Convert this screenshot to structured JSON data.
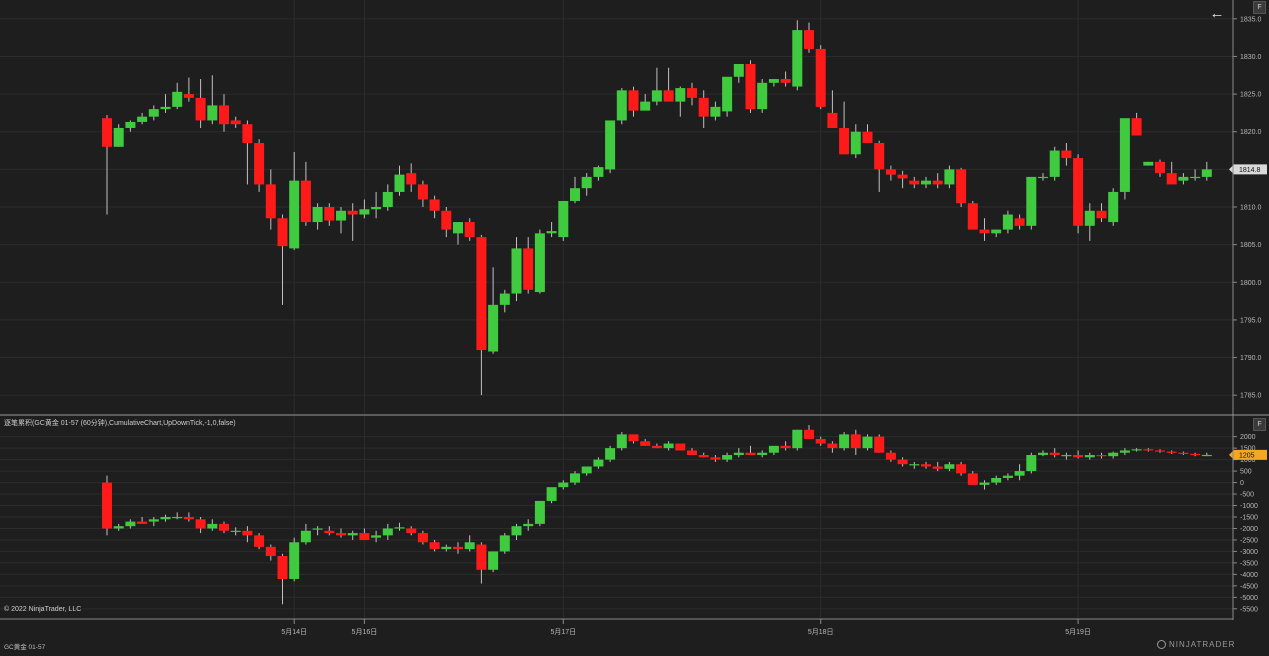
{
  "indicator_label": "逐笔累积(GC黄金 01-57 (60分钟),CumulativeChart,UpDownTick,-1,0,false)",
  "copyright": "© 2022 NinjaTrader, LLC",
  "instrument": "GC黄金 01-57",
  "brand": "NINJATRADER",
  "panel_button": "F",
  "back_icon": "arrow-left-icon",
  "colors": {
    "background": "#1e1e1e",
    "up": "#3fca3f",
    "down": "#ff1a1a",
    "grid": "#2c2c2c",
    "price_marker": "#d9d9d9",
    "indicator_marker": "#f5a623"
  },
  "chart_data": [
    {
      "type": "candlestick",
      "name": "price",
      "ylim": [
        1782.5,
        1837.5
      ],
      "yticks": [
        1785.0,
        1790.0,
        1795.0,
        1800.0,
        1805.0,
        1810.0,
        1815.0,
        1820.0,
        1825.0,
        1830.0,
        1835.0
      ],
      "last_value_label": "1814.8",
      "candles": [
        [
          1821.8,
          1822.2,
          1809.0,
          1818.0
        ],
        [
          1818.0,
          1821.0,
          1818.0,
          1820.5
        ],
        [
          1820.5,
          1821.5,
          1820.0,
          1821.3
        ],
        [
          1821.3,
          1822.5,
          1821.0,
          1822.0
        ],
        [
          1822.0,
          1823.5,
          1821.5,
          1823.0
        ],
        [
          1823.0,
          1825.0,
          1822.5,
          1823.3
        ],
        [
          1823.3,
          1826.5,
          1823.0,
          1825.3
        ],
        [
          1825.0,
          1827.2,
          1824.0,
          1824.5
        ],
        [
          1824.5,
          1827.0,
          1820.5,
          1821.5
        ],
        [
          1821.5,
          1827.5,
          1821.0,
          1823.5
        ],
        [
          1823.5,
          1825.0,
          1820.0,
          1821.0
        ],
        [
          1821.5,
          1822.0,
          1820.5,
          1821.0
        ],
        [
          1821.0,
          1821.5,
          1813.0,
          1818.5
        ],
        [
          1818.5,
          1819.0,
          1812.0,
          1813.0
        ],
        [
          1813.0,
          1815.0,
          1807.0,
          1808.5
        ],
        [
          1808.5,
          1809.0,
          1797.0,
          1804.8
        ],
        [
          1804.5,
          1817.3,
          1804.3,
          1813.5
        ],
        [
          1813.5,
          1816.0,
          1807.5,
          1808.0
        ],
        [
          1808.0,
          1810.5,
          1807.0,
          1810.0
        ],
        [
          1810.0,
          1810.5,
          1807.5,
          1808.2
        ],
        [
          1808.2,
          1810.0,
          1806.5,
          1809.5
        ],
        [
          1809.5,
          1810.5,
          1805.5,
          1809.0
        ],
        [
          1809.0,
          1811.0,
          1808.5,
          1809.7
        ],
        [
          1809.7,
          1812.0,
          1808.5,
          1810.0
        ],
        [
          1810.0,
          1813.0,
          1809.5,
          1812.0
        ],
        [
          1812.0,
          1815.5,
          1811.5,
          1814.3
        ],
        [
          1814.5,
          1815.8,
          1812.0,
          1813.0
        ],
        [
          1813.0,
          1813.5,
          1810.0,
          1811.0
        ],
        [
          1811.0,
          1811.5,
          1808.5,
          1809.5
        ],
        [
          1809.5,
          1810.0,
          1806.0,
          1807.0
        ],
        [
          1806.5,
          1808.0,
          1805.0,
          1808.0
        ],
        [
          1808.0,
          1808.5,
          1805.5,
          1806.0
        ],
        [
          1806.0,
          1806.3,
          1785.0,
          1791.0
        ],
        [
          1790.8,
          1802.0,
          1790.5,
          1797.0
        ],
        [
          1797.0,
          1799.0,
          1796.0,
          1798.5
        ],
        [
          1798.5,
          1806.0,
          1797.5,
          1804.5
        ],
        [
          1804.5,
          1806.0,
          1798.5,
          1799.0
        ],
        [
          1798.7,
          1807.0,
          1798.5,
          1806.5
        ],
        [
          1806.5,
          1808.0,
          1806.0,
          1806.8
        ],
        [
          1806.0,
          1810.5,
          1805.5,
          1810.8
        ],
        [
          1810.8,
          1814.0,
          1810.5,
          1812.5
        ],
        [
          1812.5,
          1814.5,
          1811.5,
          1814.0
        ],
        [
          1814.0,
          1815.5,
          1813.5,
          1815.3
        ],
        [
          1815.0,
          1817.0,
          1814.5,
          1821.5
        ],
        [
          1821.5,
          1825.8,
          1821.0,
          1825.5
        ],
        [
          1825.5,
          1826.0,
          1822.0,
          1822.8
        ],
        [
          1822.8,
          1825.0,
          1823.5,
          1824.0
        ],
        [
          1824.0,
          1828.5,
          1823.5,
          1825.5
        ],
        [
          1825.5,
          1828.5,
          1824.0,
          1824.0
        ],
        [
          1824.0,
          1826.0,
          1822.0,
          1825.8
        ],
        [
          1825.8,
          1826.5,
          1823.5,
          1824.5
        ],
        [
          1824.5,
          1825.5,
          1820.5,
          1822.0
        ],
        [
          1822.0,
          1824.0,
          1821.5,
          1823.3
        ],
        [
          1822.7,
          1824.0,
          1822.0,
          1827.3
        ],
        [
          1827.3,
          1828.3,
          1826.5,
          1829.0
        ],
        [
          1829.0,
          1829.5,
          1822.5,
          1823.0
        ],
        [
          1823.0,
          1827.0,
          1822.5,
          1826.5
        ],
        [
          1826.5,
          1826.8,
          1826.0,
          1827.0
        ],
        [
          1827.0,
          1828.0,
          1826.0,
          1826.5
        ],
        [
          1826.0,
          1834.8,
          1825.5,
          1833.5
        ],
        [
          1833.5,
          1834.5,
          1830.5,
          1831.0
        ],
        [
          1831.0,
          1831.5,
          1823.0,
          1823.3
        ],
        [
          1822.5,
          1825.5,
          1821.5,
          1820.5
        ],
        [
          1820.5,
          1824.0,
          1817.5,
          1817.0
        ],
        [
          1817.0,
          1821.0,
          1816.5,
          1820.0
        ],
        [
          1820.0,
          1821.0,
          1818.5,
          1818.5
        ],
        [
          1818.5,
          1818.8,
          1812.0,
          1815.0
        ],
        [
          1815.0,
          1815.5,
          1813.5,
          1814.3
        ],
        [
          1814.3,
          1814.8,
          1812.5,
          1813.8
        ],
        [
          1813.5,
          1814.0,
          1812.5,
          1813.0
        ],
        [
          1813.0,
          1814.0,
          1812.5,
          1813.5
        ],
        [
          1813.5,
          1814.5,
          1812.5,
          1813.0
        ],
        [
          1813.0,
          1815.5,
          1812.5,
          1815.0
        ],
        [
          1815.0,
          1815.2,
          1810.0,
          1810.5
        ],
        [
          1810.5,
          1810.8,
          1810.0,
          1807.0
        ],
        [
          1807.0,
          1808.5,
          1805.5,
          1806.5
        ],
        [
          1806.5,
          1807.0,
          1806.0,
          1807.0
        ],
        [
          1807.0,
          1809.5,
          1806.5,
          1809.0
        ],
        [
          1808.5,
          1809.0,
          1807.0,
          1807.5
        ],
        [
          1807.5,
          1812.0,
          1807.0,
          1814.0
        ],
        [
          1814.0,
          1814.5,
          1813.5,
          1814.0
        ],
        [
          1814.0,
          1818.0,
          1813.5,
          1817.5
        ],
        [
          1817.5,
          1818.5,
          1815.5,
          1816.5
        ],
        [
          1816.5,
          1817.0,
          1806.5,
          1807.5
        ],
        [
          1807.5,
          1810.5,
          1805.5,
          1809.5
        ],
        [
          1809.5,
          1810.5,
          1808.0,
          1808.5
        ],
        [
          1808.0,
          1812.5,
          1807.5,
          1812.0
        ],
        [
          1812.0,
          1813.0,
          1811.0,
          1821.8
        ],
        [
          1821.8,
          1822.5,
          1819.5,
          1819.5
        ],
        [
          1815.5,
          1816.0,
          1815.5,
          1816.0
        ],
        [
          1816.0,
          1816.3,
          1814.0,
          1814.5
        ],
        [
          1814.5,
          1816.0,
          1813.5,
          1813.0
        ],
        [
          1813.5,
          1814.5,
          1813.0,
          1814.0
        ],
        [
          1814.0,
          1815.0,
          1813.5,
          1814.0
        ],
        [
          1814.0,
          1816.0,
          1813.5,
          1815.0
        ]
      ]
    },
    {
      "type": "candlestick",
      "name": "indicator",
      "ylim": [
        -5900,
        2900
      ],
      "yticks": [
        -5500,
        -5000,
        -4500,
        -4000,
        -3500,
        -3000,
        -2500,
        -2000,
        -1500,
        -1000,
        -500,
        0,
        500,
        1000,
        1500,
        2000
      ],
      "last_value_label": "1205",
      "candles": [
        [
          0,
          300,
          -2300,
          -2000
        ],
        [
          -2000,
          -1800,
          -2100,
          -1900
        ],
        [
          -1900,
          -1600,
          -2000,
          -1700
        ],
        [
          -1700,
          -1500,
          -1800,
          -1800
        ],
        [
          -1700,
          -1500,
          -1900,
          -1600
        ],
        [
          -1600,
          -1400,
          -1700,
          -1500
        ],
        [
          -1500,
          -1300,
          -1600,
          -1500
        ],
        [
          -1500,
          -1300,
          -1700,
          -1600
        ],
        [
          -1600,
          -1500,
          -2200,
          -2000
        ],
        [
          -2000,
          -1600,
          -2100,
          -1800
        ],
        [
          -1800,
          -1700,
          -2200,
          -2100
        ],
        [
          -2100,
          -1950,
          -2300,
          -2100
        ],
        [
          -2100,
          -1900,
          -2600,
          -2300
        ],
        [
          -2300,
          -2200,
          -2900,
          -2800
        ],
        [
          -2800,
          -2700,
          -3400,
          -3200
        ],
        [
          -3200,
          -3100,
          -5300,
          -4200
        ],
        [
          -4200,
          -2400,
          -4300,
          -2600
        ],
        [
          -2600,
          -1800,
          -2700,
          -2100
        ],
        [
          -2000,
          -1900,
          -2300,
          -2000
        ],
        [
          -2100,
          -1900,
          -2300,
          -2200
        ],
        [
          -2200,
          -2000,
          -2400,
          -2300
        ],
        [
          -2300,
          -2100,
          -2500,
          -2200
        ],
        [
          -2200,
          -2000,
          -2400,
          -2500
        ],
        [
          -2400,
          -2100,
          -2600,
          -2300
        ],
        [
          -2300,
          -1800,
          -2500,
          -2000
        ],
        [
          -2000,
          -1750,
          -2100,
          -1950
        ],
        [
          -2000,
          -1900,
          -2300,
          -2200
        ],
        [
          -2200,
          -2100,
          -2700,
          -2600
        ],
        [
          -2600,
          -2500,
          -3000,
          -2900
        ],
        [
          -2900,
          -2700,
          -3000,
          -2800
        ],
        [
          -2800,
          -2600,
          -3100,
          -2900
        ],
        [
          -2900,
          -2300,
          -3000,
          -2600
        ],
        [
          -2700,
          -2600,
          -4400,
          -3800
        ],
        [
          -3800,
          -3000,
          -3900,
          -3000
        ],
        [
          -3000,
          -2200,
          -3100,
          -2300
        ],
        [
          -2300,
          -1800,
          -2500,
          -1900
        ],
        [
          -1900,
          -1600,
          -2100,
          -1800
        ],
        [
          -1800,
          -1200,
          -1900,
          -800
        ],
        [
          -800,
          -400,
          -900,
          -200
        ],
        [
          -200,
          100,
          -300,
          0
        ],
        [
          0,
          500,
          -100,
          400
        ],
        [
          400,
          500,
          300,
          700
        ],
        [
          700,
          1100,
          600,
          1000
        ],
        [
          1000,
          1600,
          900,
          1500
        ],
        [
          1500,
          2200,
          1400,
          2100
        ],
        [
          2100,
          2000,
          1700,
          1800
        ],
        [
          1800,
          1900,
          1600,
          1600
        ],
        [
          1600,
          1700,
          1500,
          1500
        ],
        [
          1500,
          1800,
          1400,
          1700
        ],
        [
          1700,
          1600,
          1400,
          1400
        ],
        [
          1400,
          1500,
          1200,
          1200
        ],
        [
          1200,
          1300,
          1100,
          1100
        ],
        [
          1100,
          1200,
          900,
          1000
        ],
        [
          1000,
          1300,
          900,
          1200
        ],
        [
          1200,
          1500,
          1100,
          1300
        ],
        [
          1300,
          1600,
          1200,
          1200
        ],
        [
          1200,
          1400,
          1100,
          1300
        ],
        [
          1300,
          1500,
          1200,
          1600
        ],
        [
          1600,
          1800,
          1400,
          1500
        ],
        [
          1500,
          2300,
          1400,
          2300
        ],
        [
          2300,
          2500,
          1900,
          1900
        ],
        [
          1900,
          2000,
          1600,
          1700
        ],
        [
          1700,
          1800,
          1300,
          1500
        ],
        [
          1500,
          2200,
          1400,
          2100
        ],
        [
          2100,
          2300,
          1200,
          1500
        ],
        [
          1500,
          2100,
          1400,
          2000
        ],
        [
          2000,
          2100,
          1300,
          1300
        ],
        [
          1300,
          1400,
          900,
          1000
        ],
        [
          1000,
          1100,
          700,
          800
        ],
        [
          800,
          900,
          600,
          800
        ],
        [
          800,
          900,
          600,
          700
        ],
        [
          700,
          900,
          500,
          600
        ],
        [
          600,
          900,
          500,
          800
        ],
        [
          800,
          900,
          300,
          400
        ],
        [
          400,
          500,
          -100,
          -100
        ],
        [
          -100,
          100,
          -300,
          0
        ],
        [
          0,
          300,
          -100,
          200
        ],
        [
          200,
          400,
          100,
          300
        ],
        [
          300,
          800,
          100,
          500
        ],
        [
          500,
          1300,
          400,
          1200
        ],
        [
          1200,
          1400,
          1150,
          1300
        ],
        [
          1300,
          1500,
          1100,
          1200
        ],
        [
          1200,
          1300,
          1000,
          1200
        ],
        [
          1200,
          1400,
          1050,
          1100
        ],
        [
          1100,
          1300,
          1000,
          1200
        ],
        [
          1200,
          1300,
          1050,
          1150
        ],
        [
          1150,
          1350,
          1050,
          1300
        ],
        [
          1300,
          1500,
          1200,
          1400
        ],
        [
          1400,
          1500,
          1350,
          1450
        ],
        [
          1450,
          1500,
          1350,
          1400
        ],
        [
          1400,
          1450,
          1300,
          1350
        ],
        [
          1350,
          1400,
          1250,
          1300
        ],
        [
          1300,
          1350,
          1200,
          1250
        ],
        [
          1250,
          1300,
          1150,
          1200
        ],
        [
          1200,
          1300,
          1150,
          1205
        ]
      ]
    }
  ],
  "x_axis": [
    {
      "label": "5月14日",
      "bar": 16
    },
    {
      "label": "5月16日",
      "bar": 22
    },
    {
      "label": "5月17日",
      "bar": 39
    },
    {
      "label": "5月18日",
      "bar": 61
    },
    {
      "label": "5月19日",
      "bar": 83
    }
  ]
}
